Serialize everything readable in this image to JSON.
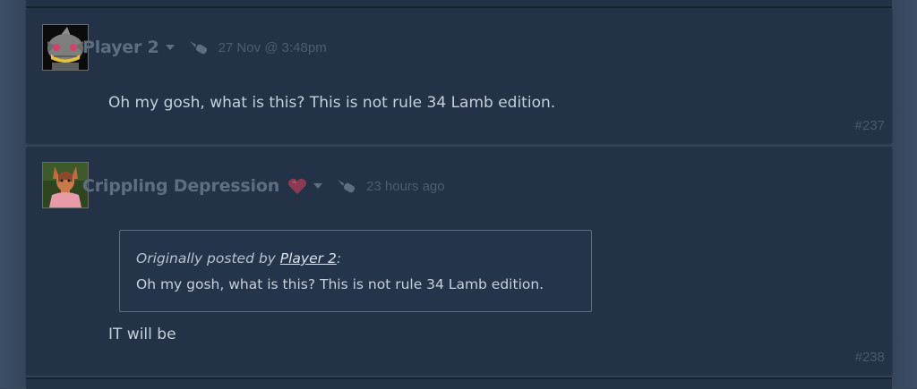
{
  "thread": {
    "comments": [
      {
        "author": "Player 2",
        "timestamp": "27 Nov @ 3:48pm",
        "text": "Oh my gosh, what is this? This is not rule 34 Lamb edition.",
        "post_number": "#237",
        "avatar_icon": "gray-creature-avatar"
      },
      {
        "author": "Crippling Depression",
        "timestamp": "23 hours ago",
        "quote": {
          "prefix": "Originally posted by ",
          "author": "Player 2",
          "suffix": ":",
          "text": "Oh my gosh, what is this? This is not rule 34 Lamb edition."
        },
        "text": "IT will be",
        "post_number": "#238",
        "avatar_icon": "fox-character-avatar",
        "badge_icon": "heart-icon"
      }
    ]
  },
  "colors": {
    "card_bg": "#233247",
    "author": "#5d6e82",
    "text": "#c6d0db",
    "heart": "#8a3b52"
  }
}
